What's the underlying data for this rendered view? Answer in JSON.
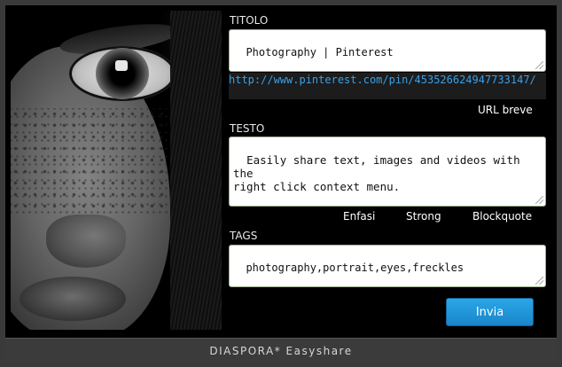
{
  "window": {
    "footer_title": "DIASPORA* Easyshare"
  },
  "photo": {
    "description_icon": "portrait-photo"
  },
  "title_section": {
    "label": "TITOLO",
    "value": "Photography | Pinterest"
  },
  "url": {
    "value": "http://www.pinterest.com/pin/453526624947733147/",
    "short_url_label": "URL breve"
  },
  "text_section": {
    "label": "TESTO",
    "value": "Easily share text, images and videos with the\nright click context menu."
  },
  "format_buttons": {
    "emphasis": "Enfasi",
    "strong": "Strong",
    "blockquote": "Blockquote"
  },
  "tags_section": {
    "label": "TAGS",
    "value": "photography,portrait,eyes,freckles"
  },
  "actions": {
    "submit_label": "Invia"
  },
  "colors": {
    "accent": "#1a86cc",
    "url_text": "#3aa0e8",
    "background": "#000000",
    "frame": "#3a3a3a"
  }
}
